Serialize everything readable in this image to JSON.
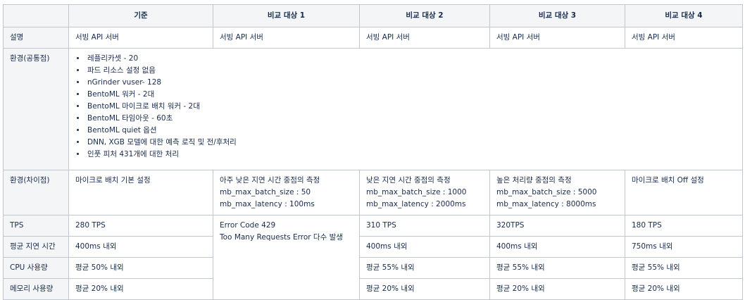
{
  "headers": [
    "",
    "기준",
    "비교 대상 1",
    "비교 대상 2",
    "비교 대상 3",
    "비교 대상 4"
  ],
  "rows": {
    "description": {
      "label": "설명",
      "cells": [
        "서빙 API 서버",
        "서빙 API 서버",
        "서빙 API 서버",
        "서빙 API 서버",
        "서빙 API 서버"
      ]
    },
    "env_common": {
      "label": "환경(공통점)",
      "items": [
        "레플리카셋 - 20",
        "파드 리소스 설정 없음",
        "nGrinder vuser- 128",
        "BentoML 워커 - 2대",
        "BentoML 마이크로 배치 워커 - 2대",
        "BentoML 타임아웃 - 60초",
        "BentoML quiet 옵션",
        "DNN, XGB 모델에 대한 예측 로직 및 전/후처리",
        "인풋 피처 431개에 대한 처리"
      ]
    },
    "env_diff": {
      "label": "환경(차이점)",
      "base": "마이크로 배치 기본 설정",
      "t1": [
        "아주 낮은 지연 시간 중점의 측정",
        "mb_max_batch_size : 50",
        "mb_max_latency : 100ms"
      ],
      "t2": [
        "낮은 지연 시간 중점의 측정",
        "mb_max_batch_size : 1000",
        "mb_max_latency : 2000ms"
      ],
      "t3": [
        "높은 처리량 중점의 측정",
        "mb_max_batch_size : 5000",
        "mb_max_latency : 8000ms"
      ],
      "t4": "마이크로 배치 Off 설정"
    },
    "tps": {
      "label": "TPS",
      "base": "280 TPS",
      "t1": [
        "Error Code 429",
        "Too Many Requests Error 다수 발생"
      ],
      "t2": "310 TPS",
      "t3": "320TPS",
      "t4": "180 TPS"
    },
    "latency": {
      "label": "평균 지연 시간",
      "base": "400ms 내외",
      "t2": "400ms 내외",
      "t3": "400ms 내외",
      "t4": "750ms 내외"
    },
    "cpu": {
      "label": "CPU 사용량",
      "base": "평균 50% 내외",
      "t2": "평균 55% 내외",
      "t3": "평균 55% 내외",
      "t4": "평균 55% 내외"
    },
    "memory": {
      "label": "메모리 사용량",
      "base": "평균 20% 내외",
      "t2": "평균 20% 내외",
      "t3": "평균 20% 내외",
      "t4": "평균 20% 내외"
    }
  }
}
